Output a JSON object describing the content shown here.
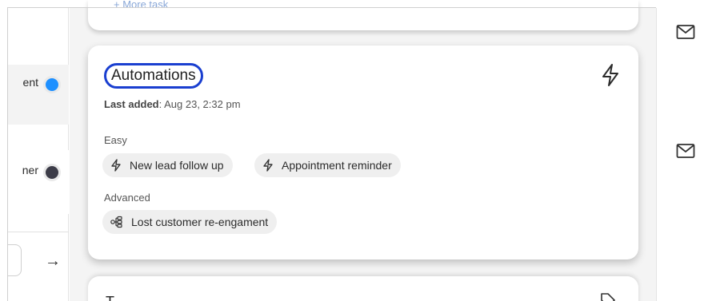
{
  "sidebar": {
    "items": [
      {
        "label": "ent",
        "toggle_color": "#1e90ff"
      },
      {
        "label": "ner",
        "toggle_color": "#3c3c48"
      }
    ],
    "pager_arrow": "→"
  },
  "previous_card": {
    "link_text": "+ More task"
  },
  "automations_card": {
    "title": "Automations",
    "last_added_label": "Last added",
    "last_added_value": ": Aug 23, 2:32 pm",
    "sections": [
      {
        "label": "Easy",
        "chips": [
          {
            "label": "New lead follow up",
            "icon": "bolt-icon"
          },
          {
            "label": "Appointment reminder",
            "icon": "bolt-icon"
          }
        ]
      },
      {
        "label": "Advanced",
        "chips": [
          {
            "label": "Lost customer re-engament",
            "icon": "workflow-icon"
          }
        ]
      }
    ],
    "header_icon": "bolt-icon",
    "title_highlight_color": "#1a3fd0"
  },
  "next_card": {
    "title": "T",
    "icon": "tag-icon"
  },
  "right_rail": {
    "icons": [
      "mail-icon",
      "mail-icon"
    ]
  }
}
